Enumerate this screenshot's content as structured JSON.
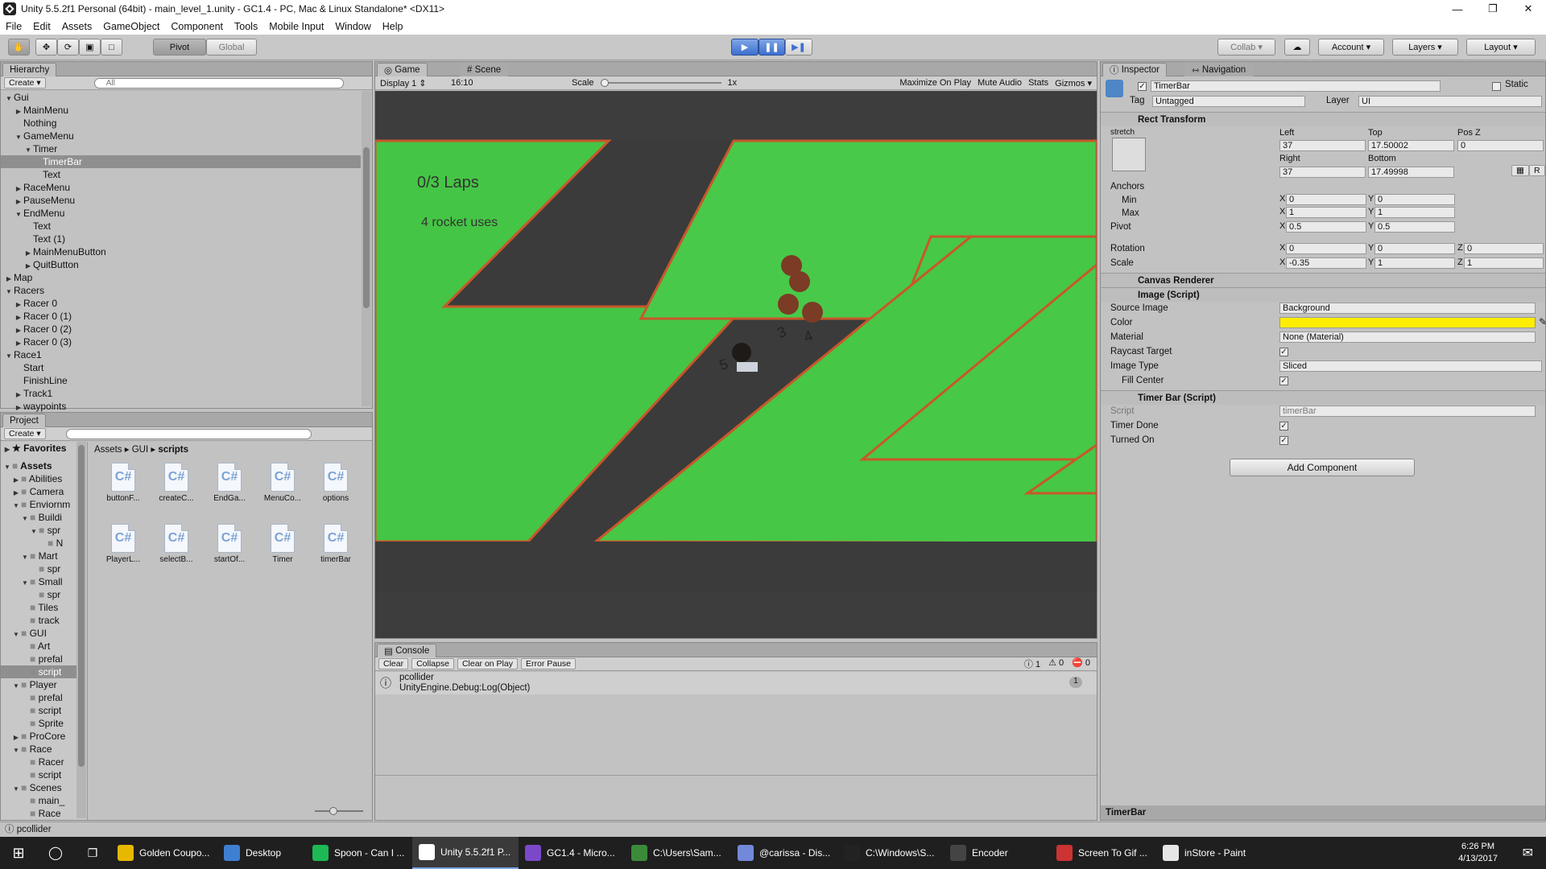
{
  "window": {
    "title": "Unity 5.5.2f1 Personal (64bit) - main_level_1.unity - GC1.4 - PC, Mac & Linux Standalone* <DX11>"
  },
  "menu": [
    "File",
    "Edit",
    "Assets",
    "GameObject",
    "Component",
    "Tools",
    "Mobile Input",
    "Window",
    "Help"
  ],
  "toolbar": {
    "pivot": "Pivot",
    "global": "Global",
    "collab": "Collab",
    "account": "Account",
    "layers": "Layers",
    "layout": "Layout"
  },
  "hierarchy": {
    "tab": "Hierarchy",
    "create": "Create",
    "search_placeholder": "All",
    "items": [
      {
        "label": "Gui",
        "depth": 0,
        "arrow": "down"
      },
      {
        "label": "MainMenu",
        "depth": 1,
        "arrow": "right"
      },
      {
        "label": "Nothing",
        "depth": 1,
        "arrow": ""
      },
      {
        "label": "GameMenu",
        "depth": 1,
        "arrow": "down"
      },
      {
        "label": "Timer",
        "depth": 2,
        "arrow": "down"
      },
      {
        "label": "TimerBar",
        "depth": 3,
        "arrow": "",
        "selected": true
      },
      {
        "label": "Text",
        "depth": 3,
        "arrow": ""
      },
      {
        "label": "RaceMenu",
        "depth": 1,
        "arrow": "right"
      },
      {
        "label": "PauseMenu",
        "depth": 1,
        "arrow": "right"
      },
      {
        "label": "EndMenu",
        "depth": 1,
        "arrow": "down"
      },
      {
        "label": "Text",
        "depth": 2,
        "arrow": ""
      },
      {
        "label": "Text (1)",
        "depth": 2,
        "arrow": ""
      },
      {
        "label": "MainMenuButton",
        "depth": 2,
        "arrow": "right"
      },
      {
        "label": "QuitButton",
        "depth": 2,
        "arrow": "right"
      },
      {
        "label": "Map",
        "depth": 0,
        "arrow": "right"
      },
      {
        "label": "Racers",
        "depth": 0,
        "arrow": "down"
      },
      {
        "label": "Racer 0",
        "depth": 1,
        "arrow": "right"
      },
      {
        "label": "Racer 0 (1)",
        "depth": 1,
        "arrow": "right"
      },
      {
        "label": "Racer 0 (2)",
        "depth": 1,
        "arrow": "right"
      },
      {
        "label": "Racer 0 (3)",
        "depth": 1,
        "arrow": "right"
      },
      {
        "label": "Race1",
        "depth": 0,
        "arrow": "down"
      },
      {
        "label": "Start",
        "depth": 1,
        "arrow": ""
      },
      {
        "label": "FinishLine",
        "depth": 1,
        "arrow": ""
      },
      {
        "label": "Track1",
        "depth": 1,
        "arrow": "right"
      },
      {
        "label": "waypoints",
        "depth": 1,
        "arrow": "right"
      }
    ]
  },
  "project": {
    "tab": "Project",
    "create": "Create",
    "favorites": "Favorites",
    "breadcrumb": [
      "Assets",
      "GUI",
      "scripts"
    ],
    "tree": [
      {
        "label": "Assets",
        "depth": 0,
        "arrow": "down",
        "bold": true
      },
      {
        "label": "Abilities",
        "depth": 1,
        "arrow": "right"
      },
      {
        "label": "Camera",
        "depth": 1,
        "arrow": "right"
      },
      {
        "label": "Enviornm",
        "depth": 1,
        "arrow": "down"
      },
      {
        "label": "Buildi",
        "depth": 2,
        "arrow": "down"
      },
      {
        "label": "spr",
        "depth": 3,
        "arrow": "down"
      },
      {
        "label": "N",
        "depth": 4,
        "arrow": ""
      },
      {
        "label": "Mart",
        "depth": 2,
        "arrow": "down"
      },
      {
        "label": "spr",
        "depth": 3,
        "arrow": ""
      },
      {
        "label": "Small",
        "depth": 2,
        "arrow": "down"
      },
      {
        "label": "spr",
        "depth": 3,
        "arrow": ""
      },
      {
        "label": "Tiles",
        "depth": 2,
        "arrow": ""
      },
      {
        "label": "track",
        "depth": 2,
        "arrow": ""
      },
      {
        "label": "GUI",
        "depth": 1,
        "arrow": "down"
      },
      {
        "label": "Art",
        "depth": 2,
        "arrow": ""
      },
      {
        "label": "prefal",
        "depth": 2,
        "arrow": ""
      },
      {
        "label": "script",
        "depth": 2,
        "arrow": "",
        "selected": true
      },
      {
        "label": "Player",
        "depth": 1,
        "arrow": "down"
      },
      {
        "label": "prefal",
        "depth": 2,
        "arrow": ""
      },
      {
        "label": "script",
        "depth": 2,
        "arrow": ""
      },
      {
        "label": "Sprite",
        "depth": 2,
        "arrow": ""
      },
      {
        "label": "ProCore",
        "depth": 1,
        "arrow": "right"
      },
      {
        "label": "Race",
        "depth": 1,
        "arrow": "down"
      },
      {
        "label": "Racer",
        "depth": 2,
        "arrow": ""
      },
      {
        "label": "script",
        "depth": 2,
        "arrow": ""
      },
      {
        "label": "Scenes",
        "depth": 1,
        "arrow": "down"
      },
      {
        "label": "main_",
        "depth": 2,
        "arrow": ""
      },
      {
        "label": "Race",
        "depth": 2,
        "arrow": ""
      }
    ],
    "files": [
      "buttonF...",
      "createC...",
      "EndGa...",
      "MenuCo...",
      "options",
      "PlayerL...",
      "selectB...",
      "startOf...",
      "Timer",
      "timerBar"
    ]
  },
  "game": {
    "tab_game": "Game",
    "tab_scene": "Scene",
    "display": "Display 1",
    "aspect": "16:10",
    "scale_label": "Scale",
    "scale_value": "1x",
    "buttons": [
      "Maximize On Play",
      "Mute Audio",
      "Stats",
      "Gizmos"
    ],
    "laps": "0/3 Laps",
    "rockets": "4 rocket uses",
    "racer_numbers": [
      "3",
      "4",
      "5"
    ]
  },
  "console": {
    "tab": "Console",
    "buttons": [
      "Clear",
      "Collapse",
      "Clear on Play",
      "Error Pause"
    ],
    "counts": [
      "1",
      "0",
      "0"
    ],
    "entry": {
      "line1": "pcollider",
      "line2": "UnityEngine.Debug:Log(Object)",
      "count": "1"
    }
  },
  "status": "pcollider",
  "inspector": {
    "tab": "Inspector",
    "tab2": "Navigation",
    "object_name": "TimerBar",
    "static_label": "Static",
    "tag_label": "Tag",
    "tag": "Untagged",
    "layer_label": "Layer",
    "layer": "UI",
    "rect": {
      "title": "Rect Transform",
      "stretch": "stretch",
      "left_label": "Left",
      "top_label": "Top",
      "posz_label": "Pos Z",
      "left": "37",
      "top": "17.50002",
      "posz": "0",
      "right_label": "Right",
      "bottom_label": "Bottom",
      "right": "37",
      "bottom": "17.49998",
      "anchors": "Anchors",
      "min": "Min",
      "max": "Max",
      "min_x": "0",
      "min_y": "0",
      "max_x": "1",
      "max_y": "1",
      "pivot": "Pivot",
      "pivot_x": "0.5",
      "pivot_y": "0.5",
      "rotation": "Rotation",
      "rot_x": "0",
      "rot_y": "0",
      "rot_z": "0",
      "scale": "Scale",
      "scale_x": "-0.35",
      "scale_y": "1",
      "scale_z": "1",
      "r_btn": "R"
    },
    "canvas_renderer": "Canvas Renderer",
    "image": {
      "title": "Image (Script)",
      "source_label": "Source Image",
      "source": "Background",
      "color_label": "Color",
      "color": "#ffee00",
      "material_label": "Material",
      "material": "None (Material)",
      "raycast_label": "Raycast Target",
      "type_label": "Image Type",
      "type": "Sliced",
      "fill_label": "Fill Center"
    },
    "timerbar": {
      "title": "Timer Bar (Script)",
      "script_label": "Script",
      "script": "timerBar",
      "done_label": "Timer Done",
      "on_label": "Turned On"
    },
    "add_component": "Add Component",
    "footer": "TimerBar"
  },
  "taskbar": {
    "items": [
      "Golden Coupo...",
      "Desktop",
      "Spoon - Can I ...",
      "Unity 5.5.2f1 P...",
      "GC1.4 - Micro...",
      "C:\\Users\\Sam...",
      "@carissa - Dis...",
      "C:\\Windows\\S...",
      "Encoder",
      "Screen To Gif ...",
      "inStore - Paint"
    ],
    "time": "6:26 PM",
    "date": "4/13/2017"
  }
}
